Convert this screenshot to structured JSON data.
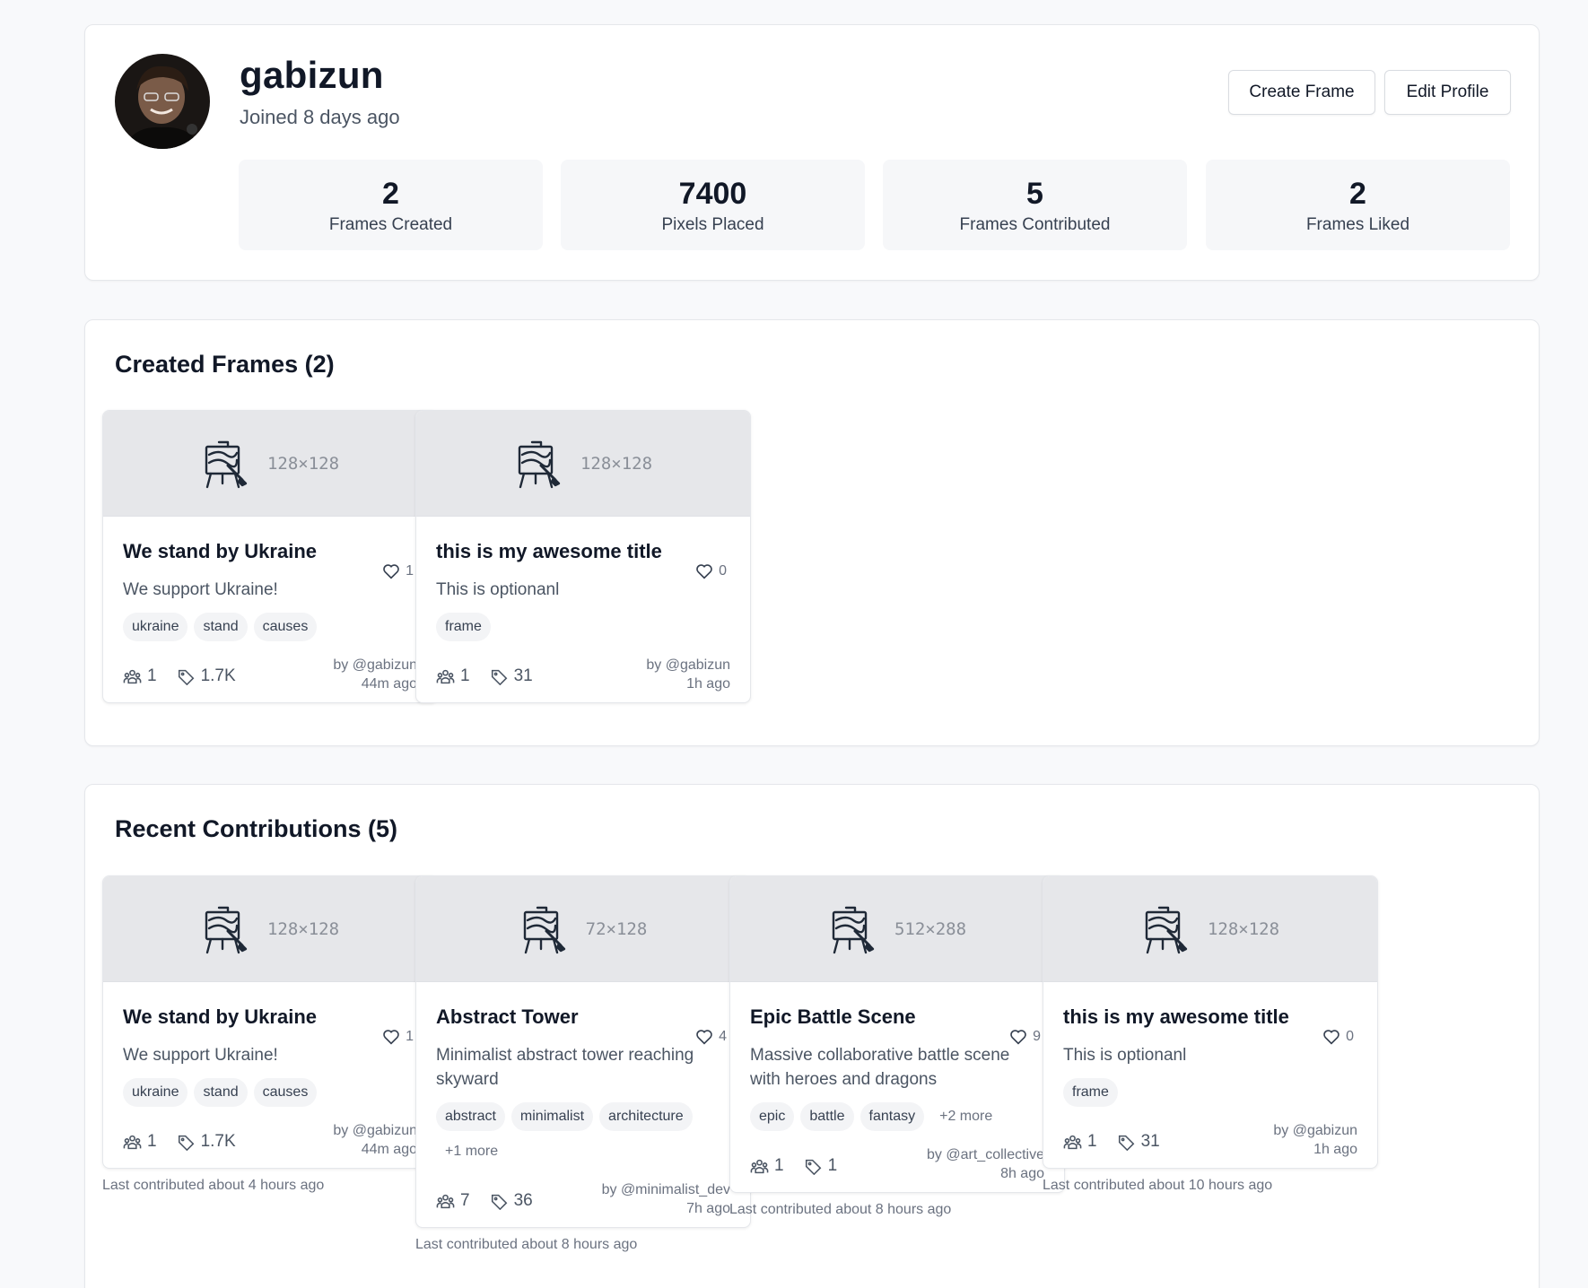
{
  "profile": {
    "username": "gabizun",
    "joined": "Joined 8 days ago",
    "buttons": {
      "create": "Create Frame",
      "edit": "Edit Profile"
    },
    "stats": [
      {
        "value": "2",
        "label": "Frames Created"
      },
      {
        "value": "7400",
        "label": "Pixels Placed"
      },
      {
        "value": "5",
        "label": "Frames Contributed"
      },
      {
        "value": "2",
        "label": "Frames Liked"
      }
    ]
  },
  "created": {
    "title": "Created Frames (2)",
    "cards": [
      {
        "dims": "128×128",
        "title": "We stand by Ukraine",
        "likes": "1",
        "desc": "We support Ukraine!",
        "tags": [
          "ukraine",
          "stand",
          "causes"
        ],
        "contributors": "1",
        "pixels": "1.7K",
        "author": "by @gabizun",
        "time": "44m ago"
      },
      {
        "dims": "128×128",
        "title": "this is my awesome title",
        "likes": "0",
        "desc": "This is optionanl",
        "tags": [
          "frame"
        ],
        "contributors": "1",
        "pixels": "31",
        "author": "by @gabizun",
        "time": "1h ago"
      }
    ]
  },
  "contributions": {
    "title": "Recent Contributions (5)",
    "cards": [
      {
        "dims": "128×128",
        "title": "We stand by Ukraine",
        "likes": "1",
        "desc": "We support Ukraine!",
        "tags": [
          "ukraine",
          "stand",
          "causes"
        ],
        "contributors": "1",
        "pixels": "1.7K",
        "author": "by @gabizun",
        "time": "44m ago",
        "last": "Last contributed about 4 hours ago"
      },
      {
        "dims": "72×128",
        "title": "Abstract Tower",
        "likes": "4",
        "desc": "Minimalist abstract tower reaching skyward",
        "tags": [
          "abstract",
          "minimalist",
          "architecture"
        ],
        "more": "+1 more",
        "contributors": "7",
        "pixels": "36",
        "author": "by @minimalist_dev",
        "time": "7h ago",
        "last": "Last contributed about 8 hours ago"
      },
      {
        "dims": "512×288",
        "title": "Epic Battle Scene",
        "likes": "9",
        "desc": "Massive collaborative battle scene with heroes and dragons",
        "tags": [
          "epic",
          "battle",
          "fantasy"
        ],
        "more": "+2 more",
        "contributors": "1",
        "pixels": "1",
        "author": "by @art_collective",
        "time": "8h ago",
        "last": "Last contributed about 8 hours ago"
      },
      {
        "dims": "128×128",
        "title": "this is my awesome title",
        "likes": "0",
        "desc": "This is optionanl",
        "tags": [
          "frame"
        ],
        "contributors": "1",
        "pixels": "31",
        "author": "by @gabizun",
        "time": "1h ago",
        "last": "Last contributed about 10 hours ago"
      }
    ]
  }
}
